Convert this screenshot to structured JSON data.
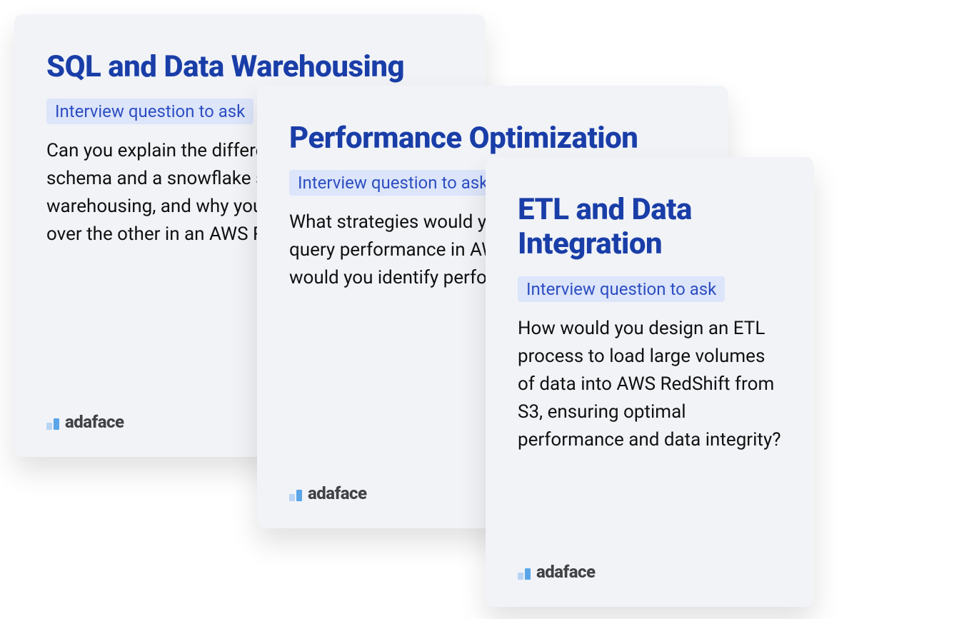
{
  "cards": [
    {
      "title": "SQL and Data Warehousing",
      "badge": "Interview question to ask",
      "body": "Can you explain the difference between a star schema and a snowflake schema in data warehousing, and why you might choose one over the other in an AWS RedShift environment?"
    },
    {
      "title": "Performance Optimization",
      "badge": "Interview question to ask",
      "body": "What strategies would you employ to improve query performance in AWS RedShift, and how would you identify performance bottlenecks?"
    },
    {
      "title": "ETL and Data Integration",
      "badge": "Interview question to ask",
      "body": "How would you design an ETL process to load large volumes of data into AWS RedShift from S3, ensuring optimal performance and data integrity?"
    }
  ],
  "brand": "adaface"
}
